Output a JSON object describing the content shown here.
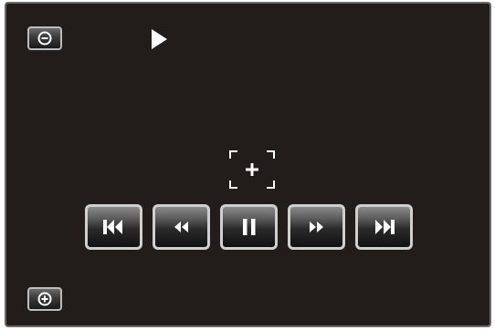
{
  "screen": {
    "background": "#221c1b",
    "border_color": "#6a6a6a"
  },
  "icons": {
    "zoom_out": "zoom-out-icon",
    "zoom_in": "zoom-in-icon",
    "playing": "play-indicator-icon",
    "focus": "focus-frame-icon",
    "skip_back": "skip-previous-icon",
    "rewind": "rewind-icon",
    "pause": "pause-icon",
    "fast_forward": "fast-forward-icon",
    "skip_next": "skip-next-icon"
  },
  "colors": {
    "icon": "#ffffff",
    "button_border": "#cfcfcf"
  }
}
